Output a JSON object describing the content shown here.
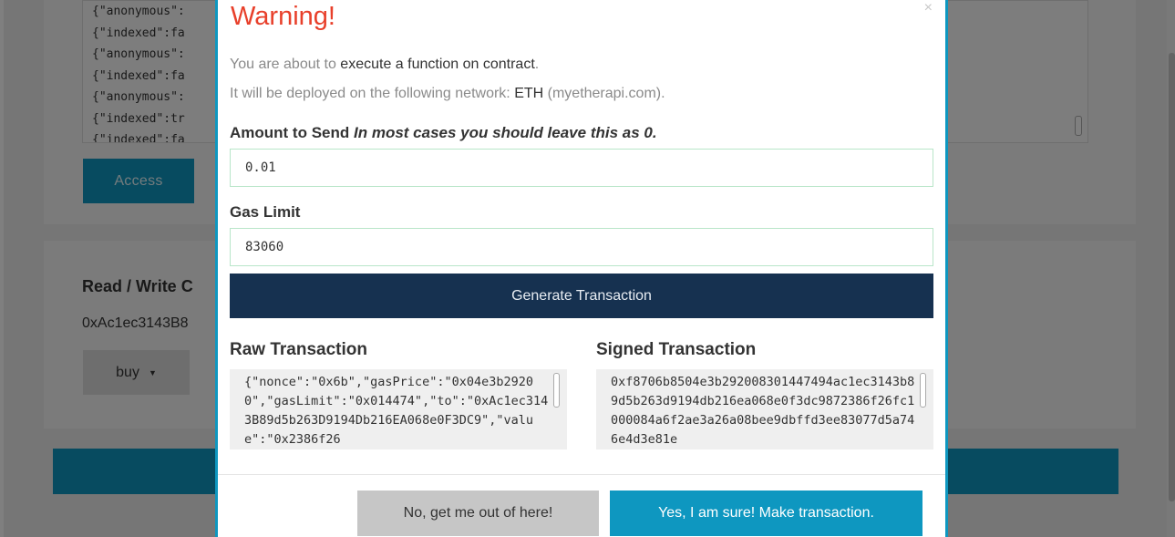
{
  "background": {
    "abi_lines": [
      "{\"anonymous\":",
      "{\"indexed\":fa",
      "{\"anonymous\":",
      "{\"indexed\":fa",
      "{\"anonymous\":",
      "{\"indexed\":tr",
      "{\"indexed\":fa"
    ],
    "access_label": "Access",
    "read_write_title": "Read / Write C",
    "contract_address": "0xAc1ec3143B8",
    "function_select": "buy",
    "colors": {
      "accent": "#0e97c0",
      "backdrop": "rgba(0,0,0,0.5)"
    }
  },
  "modal": {
    "title": "Warning!",
    "close_icon": "close-icon",
    "text1_prefix": "You are about to ",
    "text1_bold": "execute a function on contract",
    "text1_suffix": ".",
    "text2_prefix": "It will be deployed on the following network: ",
    "text2_network": "ETH",
    "text2_suffix": " (myetherapi.com).",
    "amount_label": "Amount to Send",
    "amount_hint": "In most cases you should leave this as 0.",
    "amount_value": "0.01",
    "gas_label": "Gas Limit",
    "gas_value": "83060",
    "generate_label": "Generate Transaction",
    "raw_label": "Raw Transaction",
    "raw_value": "{\"nonce\":\"0x6b\",\"gasPrice\":\"0x04e3b29200\",\"gasLimit\":\"0x014474\",\"to\":\"0xAc1ec3143B89d5b263D9194Db216EA068e0F3DC9\",\"value\":\"0x2386f26",
    "signed_label": "Signed Transaction",
    "signed_value": "0xf8706b8504e3b292008301447494ac1ec3143b89d5b263d9194db216ea068e0f3dc9872386f26fc1000084a6f2ae3a26a08bee9dbffd3ee83077d5a746e4d3e81e",
    "cancel_label": "No, get me out of here!",
    "confirm_label": "Yes, I am sure! Make transaction.",
    "colors": {
      "title": "#e8402b",
      "generate_bg": "#163150",
      "confirm_bg": "#0e97c0",
      "cancel_bg": "#c6c6c6"
    }
  }
}
